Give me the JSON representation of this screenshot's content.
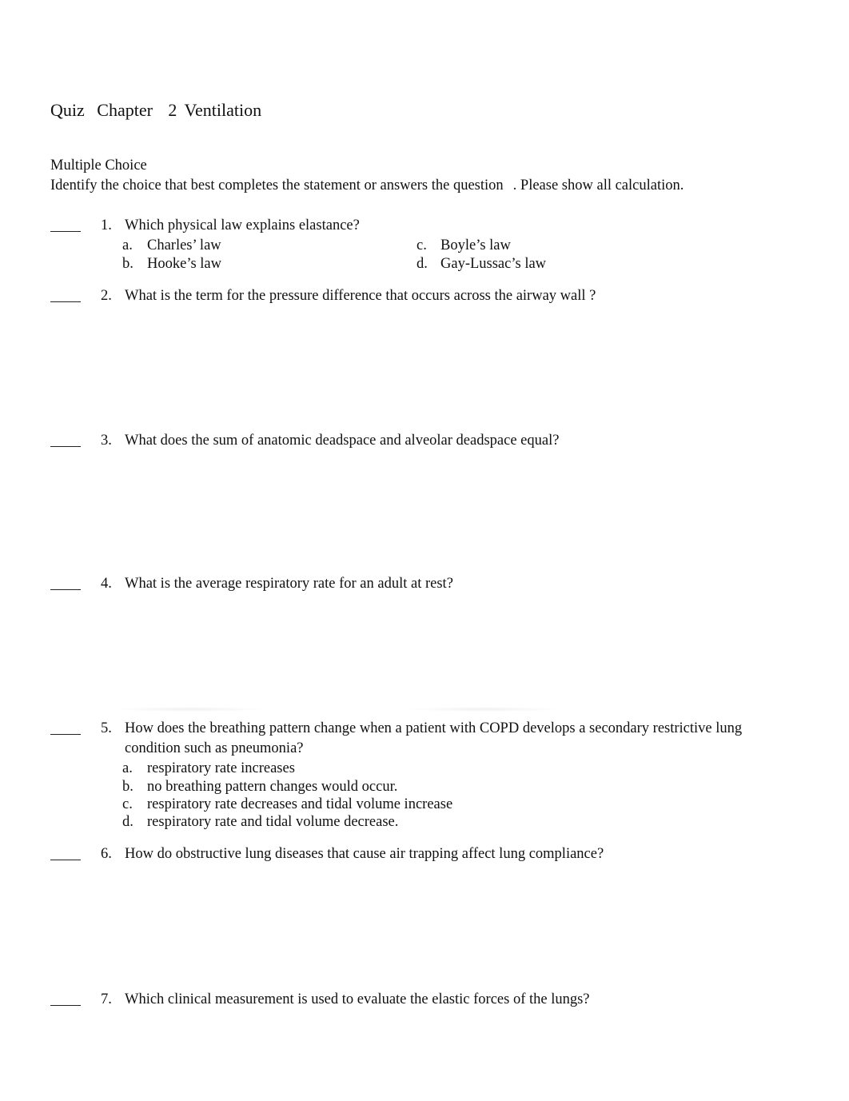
{
  "document": {
    "title_parts": [
      "Quiz",
      "Chapter",
      "2 Ventilation"
    ],
    "section_heading": "Multiple Choice",
    "instructions_part1": "Identify the choice that best completes the statement or answers the question",
    "instructions_part2": ". Please show all calculation."
  },
  "questions": [
    {
      "number": "1.",
      "text": "Which physical law explains elastance?",
      "choices": [
        {
          "letter": "a.",
          "text": "Charles’ law"
        },
        {
          "letter": "b.",
          "text": "Hooke’s law"
        },
        {
          "letter": "c.",
          "text": "Boyle’s law"
        },
        {
          "letter": "d.",
          "text": "Gay-Lussac’s law"
        }
      ]
    },
    {
      "number": "2.",
      "text": "What is the term for the pressure difference that occurs across the airway wall ?"
    },
    {
      "number": "3.",
      "text": "What does the sum of anatomic deadspace and alveolar deadspace equal?"
    },
    {
      "number": "4.",
      "text": "What is the average respiratory rate for an adult at rest?"
    },
    {
      "number": "5.",
      "text_line1": "How does the breathing pattern change when a patient with COPD develops a secondary restrictive lung",
      "text_line2": "condition such as pneumonia?",
      "choices": [
        {
          "letter": "a.",
          "text": "respiratory rate increases"
        },
        {
          "letter": "b.",
          "text": "no breathing pattern changes would occur."
        },
        {
          "letter": "c.",
          "text": "respiratory rate decreases and tidal volume increase"
        },
        {
          "letter": "d.",
          "text": "respiratory rate and tidal volume decrease."
        }
      ]
    },
    {
      "number": "6.",
      "text": "How do obstructive lung diseases that cause air trapping affect lung compliance?"
    },
    {
      "number": "7.",
      "text": "Which clinical measurement is used to evaluate the elastic forces of the lungs?"
    }
  ]
}
